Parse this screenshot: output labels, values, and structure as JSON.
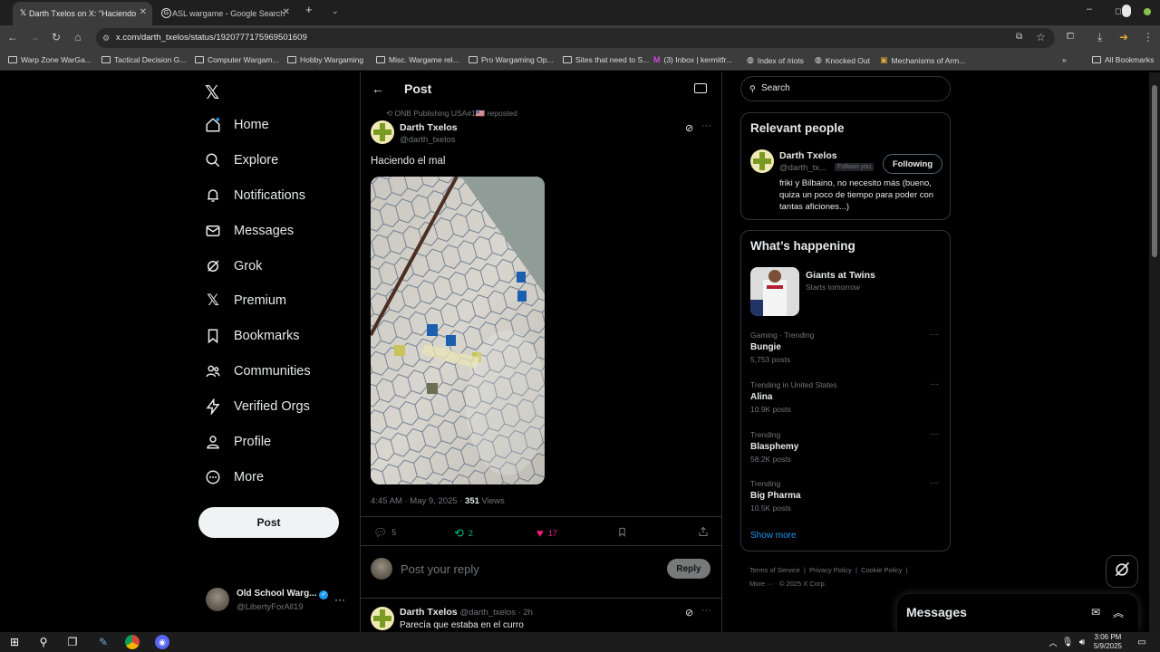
{
  "browser": {
    "tabs": [
      {
        "title": "Darth Txelos on X: \"Haciendo el",
        "active": true
      },
      {
        "title": "ASL wargame - Google Search",
        "active": false
      }
    ],
    "url": "x.com/darth_txelos/status/1920777175969501609",
    "bookmarks": [
      "Warp Zone WarGa...",
      "Tactical Decision G...",
      "Computer Wargam...",
      "Hobby Wargaming",
      "Misc. Wargame rel...",
      "Pro Wargaming Op...",
      "Sites that need to S...",
      "(3) Inbox | kermitfr...",
      "Index of /riots",
      "Knocked Out",
      "Mechanisms of Arm..."
    ],
    "all_bookmarks": "All Bookmarks"
  },
  "nav": {
    "items": [
      {
        "label": "Home",
        "icon": "home-icon"
      },
      {
        "label": "Explore",
        "icon": "search-icon"
      },
      {
        "label": "Notifications",
        "icon": "bell-icon"
      },
      {
        "label": "Messages",
        "icon": "mail-icon"
      },
      {
        "label": "Grok",
        "icon": "grok-icon"
      },
      {
        "label": "Premium",
        "icon": "x-logo-icon"
      },
      {
        "label": "Bookmarks",
        "icon": "bookmark-icon"
      },
      {
        "label": "Communities",
        "icon": "people-icon"
      },
      {
        "label": "Verified Orgs",
        "icon": "lightning-icon"
      },
      {
        "label": "Profile",
        "icon": "person-icon"
      },
      {
        "label": "More",
        "icon": "more-circle-icon"
      }
    ],
    "post_button": "Post",
    "account": {
      "name": "Old School Warg...",
      "handle": "@LibertyForAll19"
    }
  },
  "post": {
    "header_title": "Post",
    "reposted_by": "ONB Publishing USA#1🇺🇸 reposted",
    "author_name": "Darth Txelos",
    "author_handle": "@darth_txelos",
    "text": "Haciendo el mal",
    "timestamp": "4:45 AM · May 9, 2025 · ",
    "views_count": "351",
    "views_label": " Views",
    "replies": "5",
    "reposts": "2",
    "likes": "17",
    "reply_placeholder": "Post your reply",
    "reply_button": "Reply"
  },
  "next_post": {
    "author_name": "Darth Txelos",
    "meta": "@darth_txelos · 2h",
    "text": "Parecía que estaba en el curro"
  },
  "sidebar": {
    "search_placeholder": "Search",
    "relevant_title": "Relevant people",
    "person": {
      "name": "Darth Txelos",
      "handle": "@darth_tx...",
      "follows_you": "Follows you",
      "follow_label": "Following",
      "bio": "friki y Bilbaino, no necesito más (bueno, quiza un poco de tiempo para poder con tantas aficiones...)"
    },
    "happening_title": "What’s happening",
    "event": {
      "name": "Giants at Twins",
      "when": "Starts tomorrow"
    },
    "trends": [
      {
        "context": "Gaming · Trending",
        "name": "Bungie",
        "count": "5,753 posts"
      },
      {
        "context": "Trending in United States",
        "name": "Alina",
        "count": "10.9K posts"
      },
      {
        "context": "Trending",
        "name": "Blasphemy",
        "count": "58.2K posts"
      },
      {
        "context": "Trending",
        "name": "Big Pharma",
        "count": "10.5K posts"
      }
    ],
    "show_more": "Show more",
    "footer_line1": "Terms of Service  |  Privacy Policy  |  Cookie Policy  |",
    "footer_line2": "More ···   © 2025 X Corp."
  },
  "messages_dock": {
    "title": "Messages"
  },
  "taskbar": {
    "time": "3:06 PM",
    "date": "5/9/2025"
  },
  "colors": {
    "accent": "#1d9bf0",
    "like": "#f91880",
    "repost": "#00ba7c"
  }
}
